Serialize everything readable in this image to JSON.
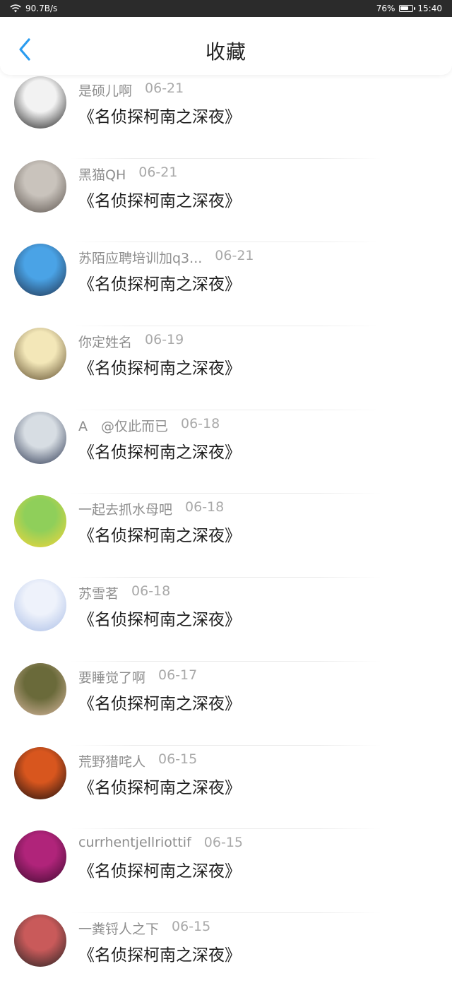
{
  "status_bar": {
    "network_speed": "90.7B/s",
    "battery_percent": "76%",
    "battery_level": 0.76,
    "time": "15:40"
  },
  "header": {
    "title": "收藏",
    "back_icon": "chevron-left-icon",
    "accent_color": "#2a9cf0"
  },
  "items": [
    {
      "username": "是硕儿啊",
      "date": "06-21",
      "title": "《名侦探柯南之深夜》",
      "avatar": "anime-girl-avatar",
      "avatar_colors": [
        "#f2f2f2",
        "#1b1b1b"
      ]
    },
    {
      "username": "黑猫QH",
      "date": "06-21",
      "title": "《名侦探柯南之深夜》",
      "avatar": "cat-butterfly-avatar",
      "avatar_colors": [
        "#c9c3bc",
        "#5a524c"
      ]
    },
    {
      "username": "苏陌应聘培训加q3...",
      "date": "06-21",
      "title": "《名侦探柯南之深夜》",
      "avatar": "girl-blue-background-avatar",
      "avatar_colors": [
        "#4aa3e6",
        "#1e2f4a"
      ]
    },
    {
      "username": "你定姓名",
      "date": "06-19",
      "title": "《名侦探柯南之深夜》",
      "avatar": "flowers-avatar",
      "avatar_colors": [
        "#f3e7b8",
        "#5c4a2a"
      ]
    },
    {
      "username": "A　@仅此而已",
      "date": "06-18",
      "title": "《名侦探柯南之深夜》",
      "avatar": "man-photo-avatar",
      "avatar_colors": [
        "#d7dde3",
        "#2a3550"
      ]
    },
    {
      "username": "一起去抓水母吧",
      "date": "06-18",
      "title": "《名侦探柯南之深夜》",
      "avatar": "spongebob-avatar",
      "avatar_colors": [
        "#8fcf5a",
        "#f5d63a"
      ]
    },
    {
      "username": "苏雪茗",
      "date": "06-18",
      "title": "《名侦探柯南之深夜》",
      "avatar": "white-anime-girl-avatar",
      "avatar_colors": [
        "#eef2fb",
        "#a9bde6"
      ]
    },
    {
      "username": "要睡觉了啊",
      "date": "06-17",
      "title": "《名侦探柯南之深夜》",
      "avatar": "woman-portrait-avatar",
      "avatar_colors": [
        "#6a6a3a",
        "#d9b8a0"
      ]
    },
    {
      "username": "荒野猎咤人",
      "date": "06-15",
      "title": "《名侦探柯南之深夜》",
      "avatar": "sunset-silhouette-avatar",
      "avatar_colors": [
        "#d8561e",
        "#1a0f0f"
      ]
    },
    {
      "username": "currhentjellriottif",
      "date": "06-15",
      "title": "《名侦探柯南之深夜》",
      "avatar": "magenta-logo-avatar",
      "avatar_colors": [
        "#b0247a",
        "#3d0a2e"
      ]
    },
    {
      "username": "一粪锊人之下",
      "date": "06-15",
      "title": "《名侦探柯南之深夜》",
      "avatar": "couple-photo-avatar",
      "avatar_colors": [
        "#c95a5a",
        "#222222"
      ]
    }
  ]
}
